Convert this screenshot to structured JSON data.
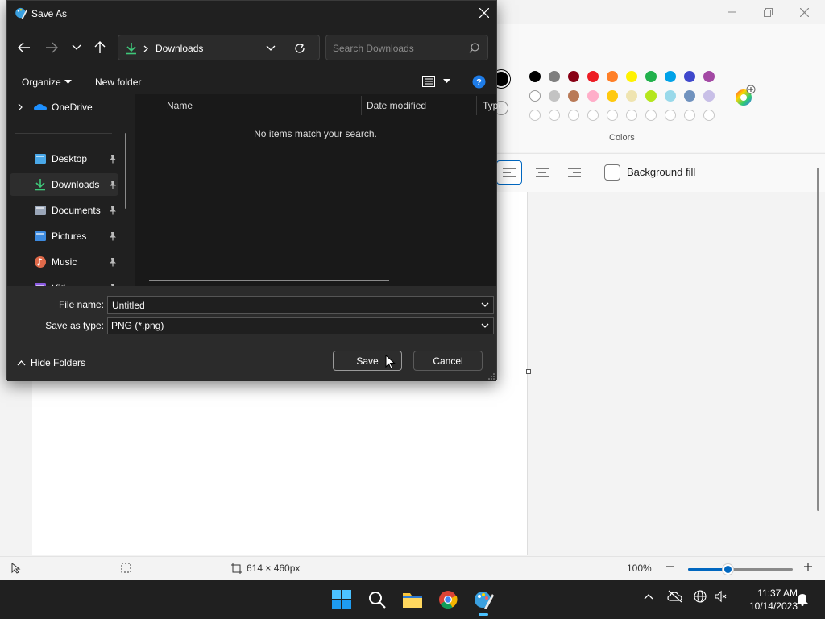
{
  "dialog": {
    "title": "Save As",
    "address": {
      "current": "Downloads"
    },
    "search": {
      "placeholder": "Search Downloads"
    },
    "commands": {
      "organize": "Organize",
      "new_folder": "New folder"
    },
    "nav_items": [
      {
        "label": "OneDrive",
        "icon": "onedrive-icon"
      },
      {
        "label": "Desktop",
        "icon": "desktop-folder-icon",
        "pinned": true
      },
      {
        "label": "Downloads",
        "icon": "download-folder-icon",
        "pinned": true,
        "selected": true
      },
      {
        "label": "Documents",
        "icon": "documents-folder-icon",
        "pinned": true
      },
      {
        "label": "Pictures",
        "icon": "pictures-folder-icon",
        "pinned": true
      },
      {
        "label": "Music",
        "icon": "music-folder-icon",
        "pinned": true
      },
      {
        "label": "Vid",
        "icon": "videos-folder-icon",
        "pinned": true
      }
    ],
    "columns": [
      "Name",
      "Date modified",
      "Type"
    ],
    "empty_message": "No items match your search.",
    "file_name": {
      "label": "File name:",
      "value": "Untitled"
    },
    "save_as_type": {
      "label": "Save as type:",
      "value": "PNG (*.png)"
    },
    "hide_folders": "Hide Folders",
    "save_button": "Save",
    "cancel_button": "Cancel"
  },
  "paint": {
    "colors_label": "Colors",
    "background_fill_label": "Background fill",
    "palette_row1": [
      "#000000",
      "#7f7f7f",
      "#880015",
      "#ed1c24",
      "#ff7f27",
      "#fff200",
      "#22b14c",
      "#00a2e8",
      "#3f48cc",
      "#a349a4"
    ],
    "palette_row2": [
      "#ffffff",
      "#c3c3c3",
      "#b97a57",
      "#ffaec9",
      "#ffc90e",
      "#efe4b0",
      "#b5e61d",
      "#99d9ea",
      "#7092be",
      "#c8bfe7"
    ],
    "canvas_size": "614 × 460px",
    "zoom": "100%",
    "zoom_fraction": 0.38
  },
  "taskbar": {
    "time": "11:37 AM",
    "date": "10/14/2023"
  },
  "colors": {
    "accent": "#0067c0",
    "dialog_bg": "#202020",
    "taskbar_bg": "#202020"
  }
}
